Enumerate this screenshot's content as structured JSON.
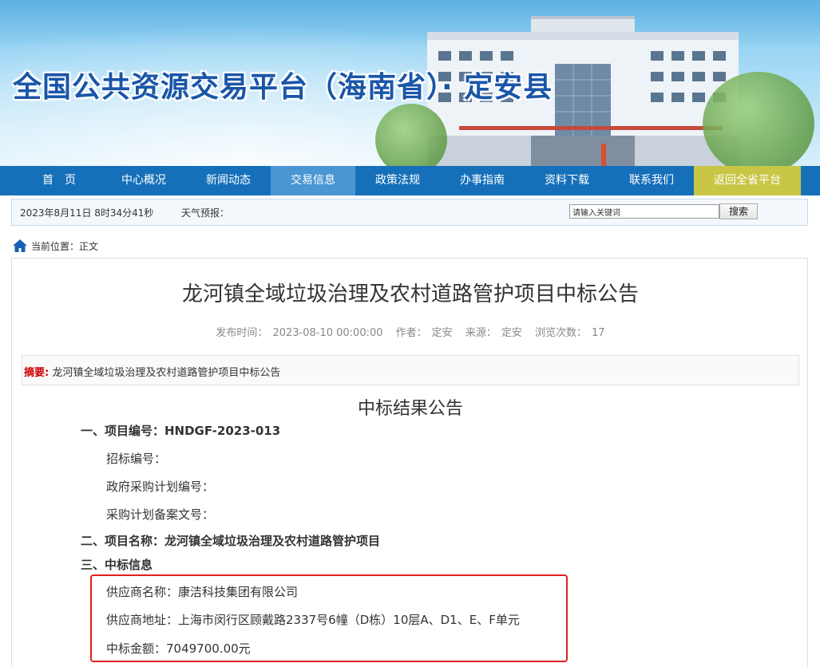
{
  "site": {
    "title": "全国公共资源交易平台（海南省）· 定安县"
  },
  "nav": {
    "items": [
      "首　页",
      "中心概况",
      "新闻动态",
      "交易信息",
      "政策法规",
      "办事指南",
      "资料下载",
      "联系我们",
      "返回全省平台"
    ],
    "active_index": 3
  },
  "infobar": {
    "datetime": "2023年8月11日 8时34分41秒",
    "weather_label": "天气预报：",
    "search_placeholder": "请输入关键词",
    "search_button": "搜索"
  },
  "breadcrumb": {
    "label": "当前位置：",
    "current": "正文"
  },
  "article": {
    "title": "龙河镇全域垃圾治理及农村道路管护项目中标公告",
    "meta": {
      "publish_label": "发布时间：",
      "publish_time": "2023-08-10 00:00:00",
      "author_label": "作者：",
      "author": "定安",
      "source_label": "来源：",
      "source": "定安",
      "views_label": "浏览次数：",
      "views": "17"
    },
    "summary": {
      "label": "摘要:",
      "text": "龙河镇全域垃圾治理及农村道路管护项目中标公告"
    },
    "doc_title": "中标结果公告",
    "lines": {
      "section1": "一、项目编号：HNDGF-2023-013",
      "tender_no": "招标编号：",
      "plan_no": "政府采购计划编号：",
      "filing_no": "采购计划备案文号：",
      "section2": "二、项目名称：龙河镇全域垃圾治理及农村道路管护项目",
      "section3": "三、中标信息",
      "supplier_name": "供应商名称：康洁科技集团有限公司",
      "supplier_address": "供应商地址：上海市闵行区顾戴路2337号6幢（D栋）10层A、D1、E、F单元",
      "amount": "中标金额：7049700.00元"
    }
  },
  "colors": {
    "nav_bg": "#1670b9",
    "nav_active": "#4a96d3",
    "nav_platform": "#c9c646",
    "highlight": "#e02020"
  },
  "icons": {
    "breadcrumb": "home-icon"
  }
}
